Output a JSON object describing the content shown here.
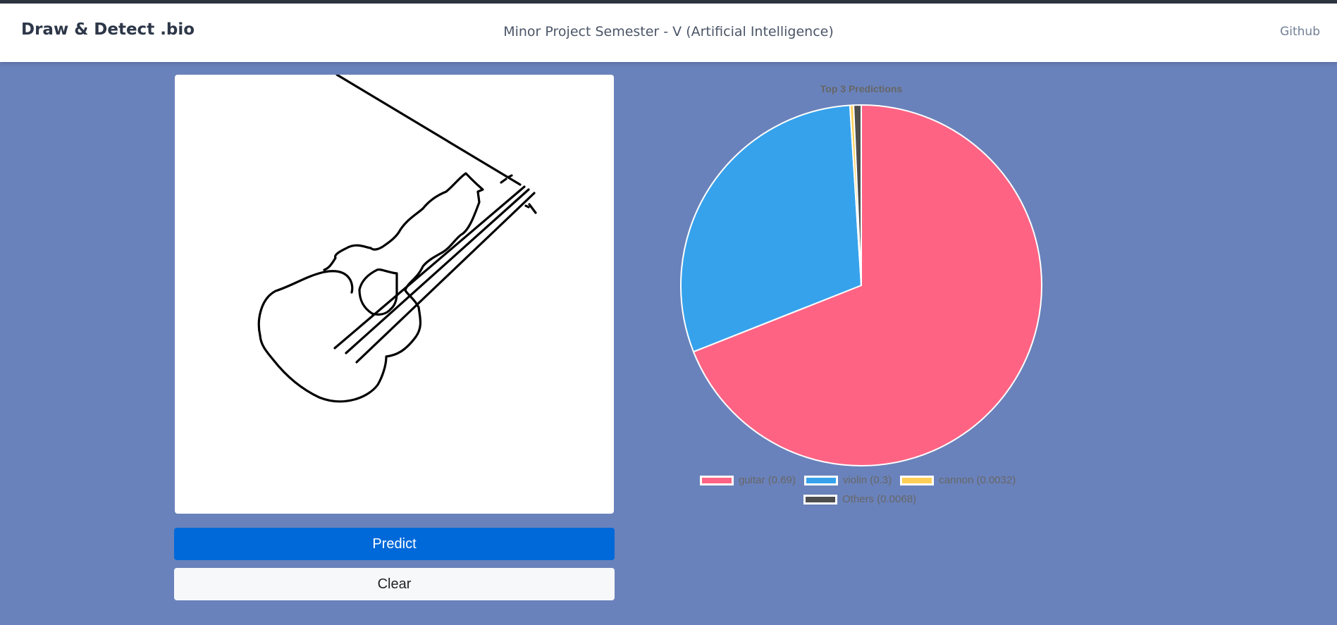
{
  "header": {
    "brand": "Draw & Detect .bio",
    "subtitle": "Minor Project Semester - V (Artificial Intelligence)",
    "github_link": "Github"
  },
  "buttons": {
    "predict_label": "Predict",
    "clear_label": "Clear"
  },
  "chart_data": {
    "type": "pie",
    "title": "Top 3 Predictions",
    "labels": [
      "guitar (0.69)",
      "violin (0.3)",
      "cannon (0.0032)",
      "Others (0.0068)"
    ],
    "values": [
      0.69,
      0.3,
      0.0032,
      0.0068
    ],
    "colors": [
      "#ff6384",
      "#36a2eb",
      "#ffce56",
      "#4d4d4d"
    ],
    "legend_position": "bottom"
  }
}
